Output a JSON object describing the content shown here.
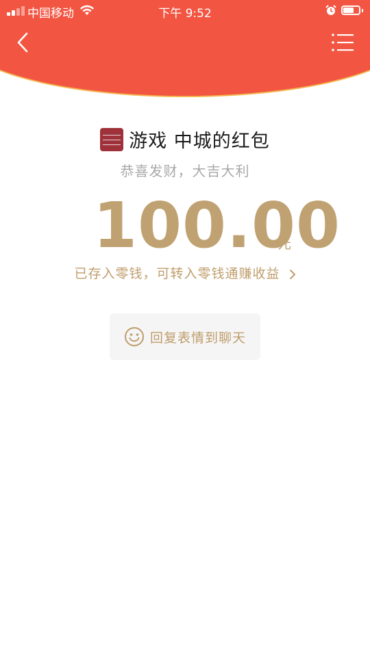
{
  "status_bar": {
    "carrier": "中国移动",
    "time": "下午 9:52",
    "battery_level": 0.7
  },
  "nav": {
    "back_icon": "chevron-left-icon",
    "menu_icon": "list-icon"
  },
  "colors": {
    "header_red": "#f25542",
    "gold_text": "#c0a272",
    "gray_text": "#a8a8a8"
  },
  "red_packet": {
    "sender_name": "游戏 中城的红包",
    "wishes": "恭喜发财，大吉大利",
    "amount": "100.00",
    "unit": "元",
    "deposit_text": "已存入零钱，可转入零钱通赚收益"
  },
  "reply": {
    "label": "回复表情到聊天",
    "icon": "smiley-icon"
  }
}
